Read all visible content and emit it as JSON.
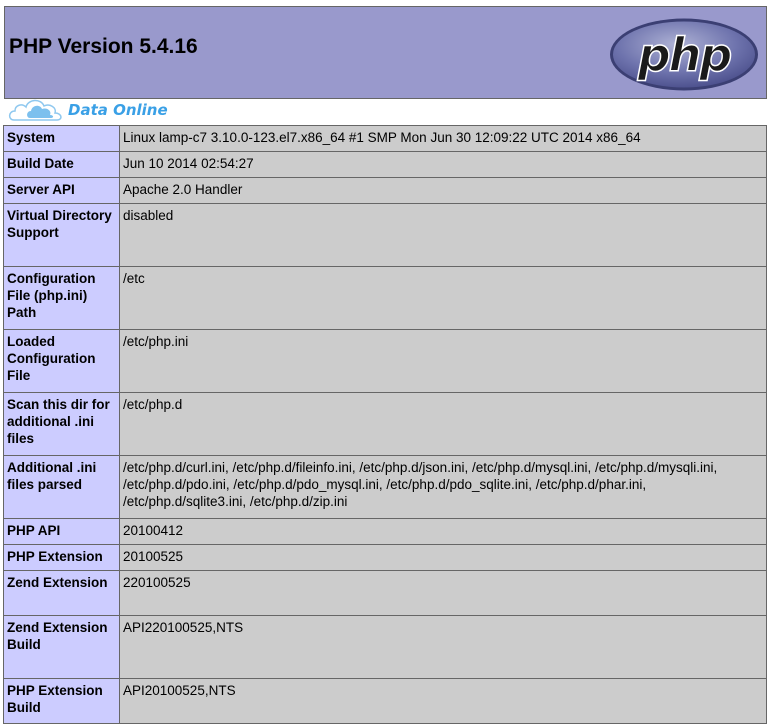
{
  "header": {
    "title": "PHP Version 5.4.16",
    "logo_text": "php"
  },
  "watermark": {
    "text": "Data Online"
  },
  "rows": [
    {
      "key": "System",
      "value": "Linux lamp-c7 3.10.0-123.el7.x86_64 #1 SMP Mon Jun 30 12:09:22 UTC 2014 x86_64"
    },
    {
      "key": "Build Date",
      "value": "Jun 10 2014 02:54:27"
    },
    {
      "key": "Server API",
      "value": "Apache 2.0 Handler"
    },
    {
      "key": "Virtual Directory Support",
      "value": "disabled"
    },
    {
      "key": "Configuration File (php.ini) Path",
      "value": "/etc"
    },
    {
      "key": "Loaded Configuration File",
      "value": "/etc/php.ini"
    },
    {
      "key": "Scan this dir for additional .ini files",
      "value": "/etc/php.d"
    },
    {
      "key": "Additional .ini files parsed",
      "value": "/etc/php.d/curl.ini, /etc/php.d/fileinfo.ini, /etc/php.d/json.ini, /etc/php.d/mysql.ini, /etc/php.d/mysqli.ini, /etc/php.d/pdo.ini, /etc/php.d/pdo_mysql.ini, /etc/php.d/pdo_sqlite.ini, /etc/php.d/phar.ini, /etc/php.d/sqlite3.ini, /etc/php.d/zip.ini"
    },
    {
      "key": "PHP API",
      "value": "20100412"
    },
    {
      "key": "PHP Extension",
      "value": "20100525"
    },
    {
      "key": "Zend Extension",
      "value": "220100525"
    },
    {
      "key": "Zend Extension Build",
      "value": "API220100525,NTS"
    },
    {
      "key": "PHP Extension Build",
      "value": "API20100525,NTS"
    }
  ],
  "colors": {
    "header_bg": "#9999cc",
    "key_bg": "#ccccff",
    "value_bg": "#cccccc",
    "watermark": "#3aa0e6"
  }
}
